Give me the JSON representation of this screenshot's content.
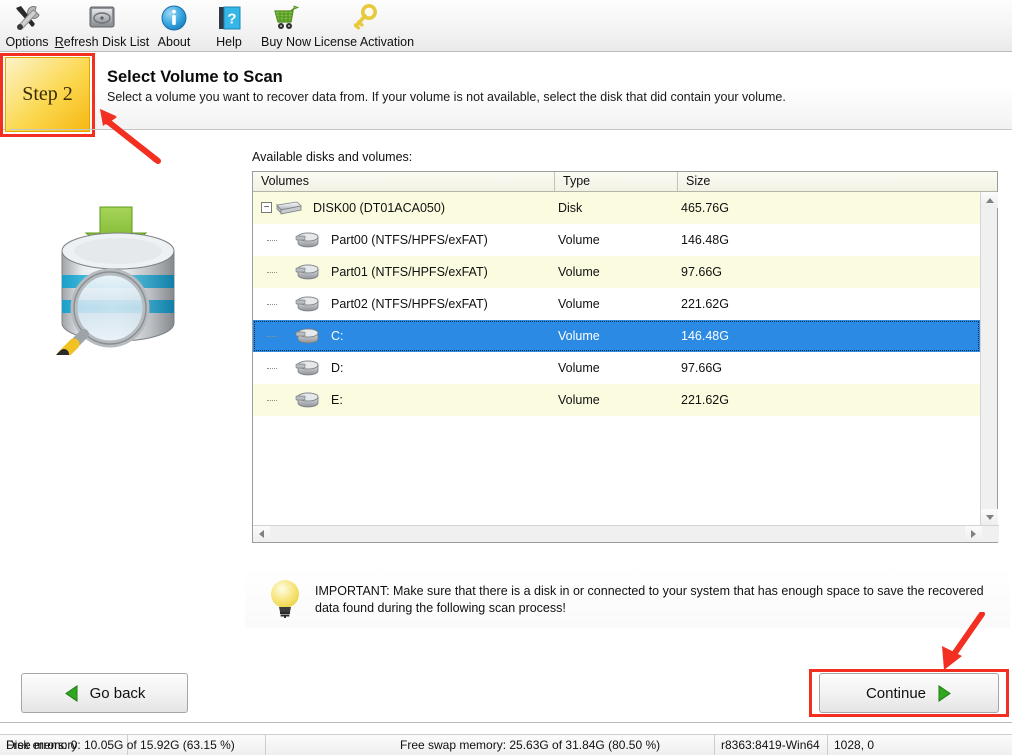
{
  "toolbar": {
    "items": [
      {
        "label": "Options",
        "icon": "tools-icon",
        "underline": ""
      },
      {
        "label": "Refresh Disk List",
        "icon": "disk-drive-icon",
        "underline": "R"
      },
      {
        "label": "About",
        "icon": "info-circle-icon",
        "underline": ""
      },
      {
        "label": "Help",
        "icon": "help-book-icon",
        "underline": ""
      },
      {
        "label": "Buy Now",
        "icon": "shopping-cart-icon",
        "underline": ""
      },
      {
        "label": "License Activation",
        "icon": "key-icon",
        "underline": ""
      }
    ]
  },
  "header": {
    "step_label": "Step 2",
    "title": "Select Volume to Scan",
    "subtitle": "Select a volume you want to recover data from. If your volume is not available, select the disk that did contain your volume."
  },
  "illustration": {
    "name": "database-scan-icon"
  },
  "table": {
    "caption": "Available disks and volumes:",
    "columns": [
      "Volumes",
      "Type",
      "Size"
    ],
    "rows": [
      {
        "name": "DISK00 (DT01ACA050)",
        "type": "Disk",
        "size": "465.76G",
        "level": 0,
        "expander": "−",
        "selected": false,
        "stripe": "odd"
      },
      {
        "name": "Part00 (NTFS/HPFS/exFAT)",
        "type": "Volume",
        "size": "146.48G",
        "level": 1,
        "expander": "",
        "selected": false,
        "stripe": "even"
      },
      {
        "name": "Part01 (NTFS/HPFS/exFAT)",
        "type": "Volume",
        "size": "97.66G",
        "level": 1,
        "expander": "",
        "selected": false,
        "stripe": "odd"
      },
      {
        "name": "Part02 (NTFS/HPFS/exFAT)",
        "type": "Volume",
        "size": "221.62G",
        "level": 1,
        "expander": "",
        "selected": false,
        "stripe": "even"
      },
      {
        "name": "C:",
        "type": "Volume",
        "size": "146.48G",
        "level": 1,
        "expander": "",
        "selected": true,
        "stripe": "odd"
      },
      {
        "name": "D:",
        "type": "Volume",
        "size": "97.66G",
        "level": 1,
        "expander": "",
        "selected": false,
        "stripe": "even"
      },
      {
        "name": "E:",
        "type": "Volume",
        "size": "221.62G",
        "level": 1,
        "expander": "",
        "selected": false,
        "stripe": "odd"
      }
    ]
  },
  "note": {
    "icon": "lightbulb-icon",
    "text": "IMPORTANT: Make sure that there is a disk in or connected to your system that has enough space to save the recovered data found during the following scan process!"
  },
  "buttons": {
    "go_back": "Go back",
    "continue": "Continue"
  },
  "statusbar": {
    "fields": [
      "Disk errors: 0",
      "Free memory: 10.05G of 15.92G (63.15 %)",
      "Free swap memory: 25.63G of 31.84G (80.50 %)",
      "r8363:8419-Win64",
      "1028, 0"
    ]
  },
  "colors": {
    "annotation_red": "#f22f20",
    "selection_blue": "#2a8ae4",
    "row_stripe": "#fbfbe0",
    "step_gold": "#f6b713",
    "accent_green": "#76b82a"
  }
}
